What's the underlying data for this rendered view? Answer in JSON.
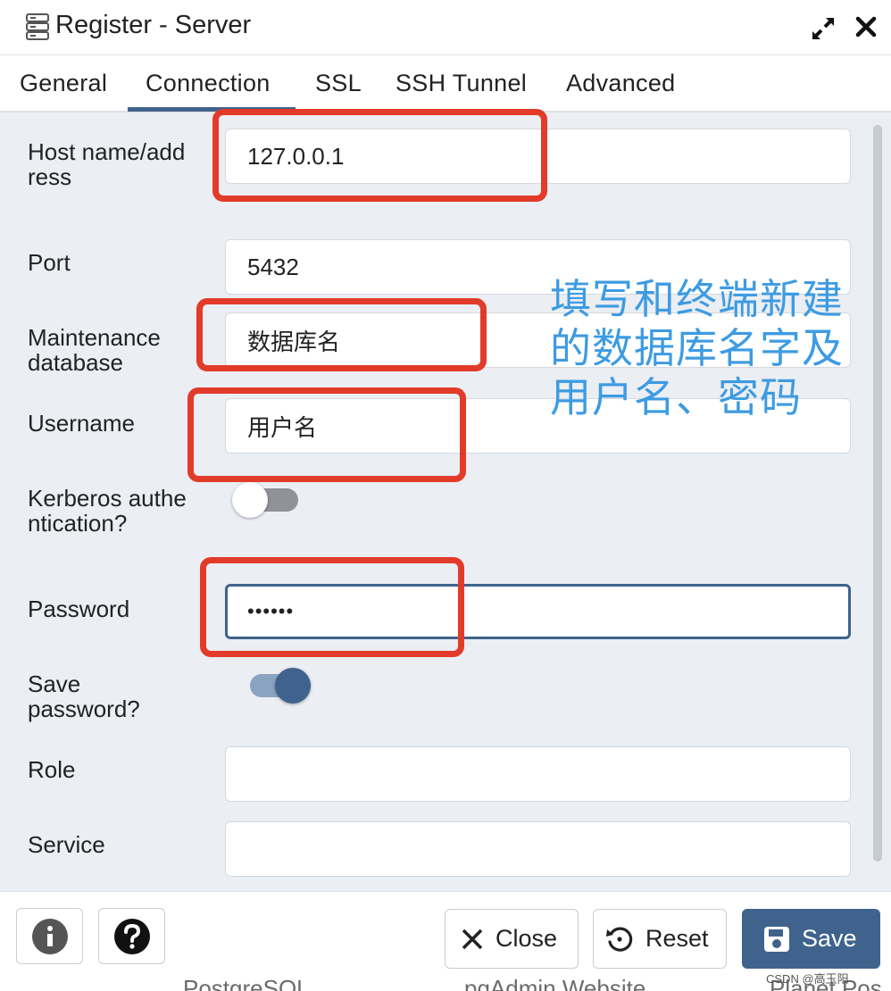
{
  "window": {
    "title": "Register - Server",
    "title_icon": "server-icon",
    "maximize_icon": "expand-icon",
    "close_icon": "close-icon"
  },
  "tabs": [
    {
      "label": "General",
      "active": false
    },
    {
      "label": "Connection",
      "active": true
    },
    {
      "label": "SSL",
      "active": false
    },
    {
      "label": "SSH Tunnel",
      "active": false
    },
    {
      "label": "Advanced",
      "active": false
    }
  ],
  "form": {
    "host": {
      "label": "Host name/address",
      "value": "127.0.0.1"
    },
    "port": {
      "label": "Port",
      "value": "5432"
    },
    "maintenance_db": {
      "label": "Maintenance database",
      "value": "数据库名"
    },
    "username": {
      "label": "Username",
      "value": "用户名"
    },
    "kerberos": {
      "label": "Kerberos authentication?",
      "enabled": false
    },
    "password": {
      "label": "Password",
      "value": "••••••"
    },
    "save_password": {
      "label": "Save password?",
      "enabled": true
    },
    "role": {
      "label": "Role",
      "value": ""
    },
    "service": {
      "label": "Service",
      "value": ""
    }
  },
  "annotation": {
    "line1": "填写和终端新建",
    "line2": "的数据库名字及",
    "line3": "用户名、密码"
  },
  "footer": {
    "info_icon": "info-icon",
    "help_icon": "help-icon",
    "close_label": "Close",
    "reset_label": "Reset",
    "save_label": "Save"
  },
  "background_text": [
    "PostgreSQL",
    "pgAdmin Website",
    "Planet Pos"
  ],
  "watermark": "CSDN @高玉阳",
  "colors": {
    "accent": "#3f638c",
    "highlight_box": "#e23b2a",
    "annotation_text": "#3d9be2",
    "form_background": "#ebeef3"
  }
}
